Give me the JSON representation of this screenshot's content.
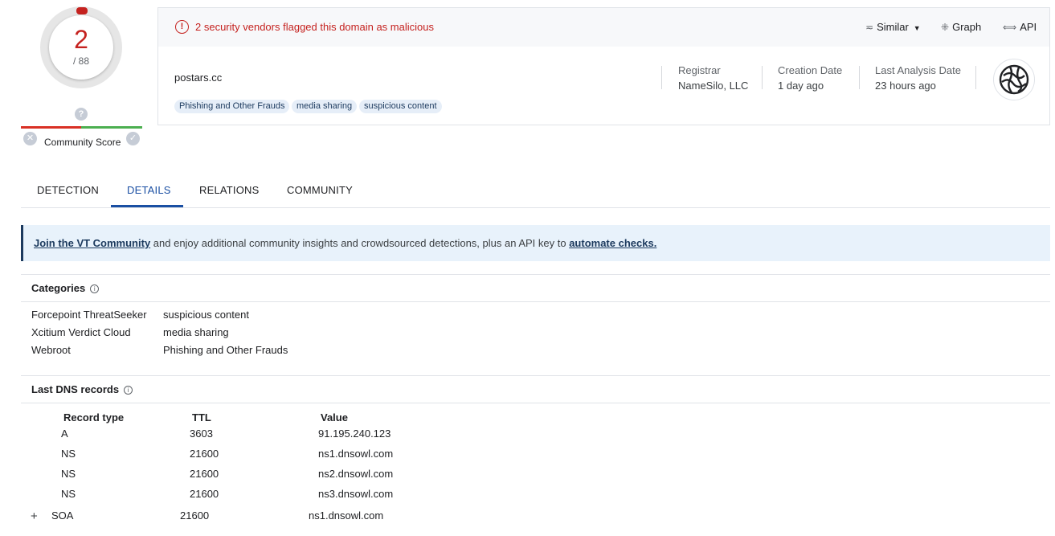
{
  "score": {
    "detections": "2",
    "total": "/ 88"
  },
  "community": {
    "question_glyph": "?",
    "dislike_glyph": "✕",
    "like_glyph": "✓",
    "label": "Community Score"
  },
  "alert": {
    "icon_glyph": "!",
    "message": "2 security vendors flagged this domain as malicious"
  },
  "toolbar": {
    "similar": "Similar",
    "graph": "Graph",
    "api": "API"
  },
  "domain": {
    "name": "postars.cc",
    "tags": [
      "Phishing and Other Frauds",
      "media sharing",
      "suspicious content"
    ]
  },
  "meta": {
    "registrar_label": "Registrar",
    "registrar_value": "NameSilo, LLC",
    "creation_label": "Creation Date",
    "creation_value": "1 day ago",
    "analysis_label": "Last Analysis Date",
    "analysis_value": "23 hours ago"
  },
  "tabs": [
    "DETECTION",
    "DETAILS",
    "RELATIONS",
    "COMMUNITY"
  ],
  "active_tab": "DETAILS",
  "banner": {
    "link1": "Join the VT Community",
    "middle": " and enjoy additional community insights and crowdsourced detections, plus an API key to ",
    "link2": "automate checks."
  },
  "categories": {
    "title": "Categories",
    "info_glyph": "i",
    "rows": [
      {
        "vendor": "Forcepoint ThreatSeeker",
        "value": "suspicious content"
      },
      {
        "vendor": "Xcitium Verdict Cloud",
        "value": "media sharing"
      },
      {
        "vendor": "Webroot",
        "value": "Phishing and Other Frauds"
      }
    ]
  },
  "dns": {
    "title": "Last DNS records",
    "info_glyph": "i",
    "headers": [
      "Record type",
      "TTL",
      "Value"
    ],
    "rows": [
      {
        "type": "A",
        "ttl": "3603",
        "value": "91.195.240.123"
      },
      {
        "type": "NS",
        "ttl": "21600",
        "value": "ns1.dnsowl.com"
      },
      {
        "type": "NS",
        "ttl": "21600",
        "value": "ns2.dnsowl.com"
      },
      {
        "type": "NS",
        "ttl": "21600",
        "value": "ns3.dnsowl.com"
      },
      {
        "type": "SOA",
        "ttl": "21600",
        "value": "ns1.dnsowl.com"
      }
    ],
    "expand_glyph": "+"
  },
  "colors": {
    "malicious": "#c5221f",
    "accent": "#1a4fa3",
    "banner_bg": "#e8f2fb",
    "tag_bg": "#e6eef8"
  }
}
